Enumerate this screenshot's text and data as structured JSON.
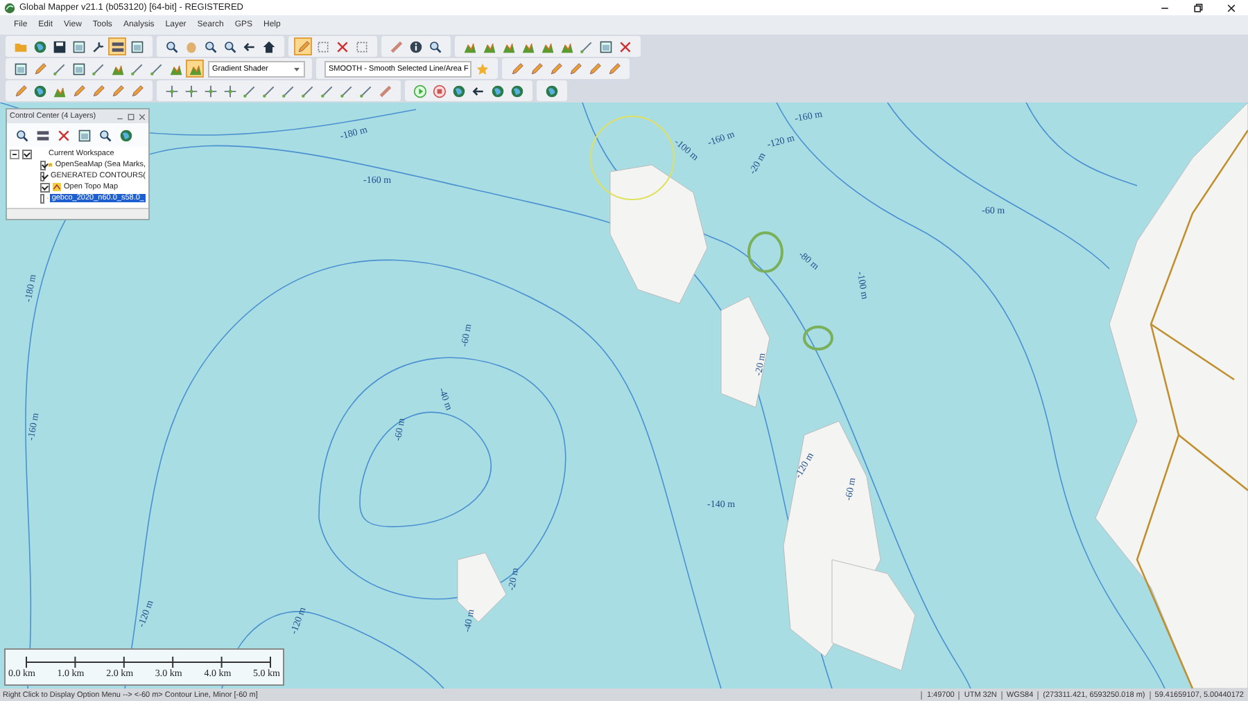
{
  "window": {
    "title": "Global Mapper v21.1 (b053120) [64-bit] - REGISTERED"
  },
  "menu": [
    "File",
    "Edit",
    "View",
    "Tools",
    "Analysis",
    "Layer",
    "Search",
    "GPS",
    "Help"
  ],
  "toolbars": [
    {
      "groups": [
        [
          {
            "kind": "button",
            "selected": false
          },
          {
            "kind": "button",
            "selected": false
          },
          {
            "kind": "button",
            "selected": false
          },
          {
            "kind": "button",
            "selected": false
          },
          {
            "kind": "button",
            "selected": false
          },
          {
            "kind": "button",
            "selected": true
          },
          {
            "kind": "button",
            "selected": false
          }
        ],
        [
          {
            "kind": "button",
            "selected": false
          },
          {
            "kind": "button",
            "selected": false
          },
          {
            "kind": "button",
            "selected": false
          },
          {
            "kind": "button",
            "selected": false
          },
          {
            "kind": "button",
            "selected": false
          },
          {
            "kind": "button",
            "selected": false
          }
        ],
        [
          {
            "kind": "button",
            "selected": true
          },
          {
            "kind": "button",
            "selected": false
          },
          {
            "kind": "button",
            "selected": false
          },
          {
            "kind": "button",
            "selected": false
          }
        ],
        [
          {
            "kind": "button",
            "selected": false
          },
          {
            "kind": "button",
            "selected": false
          },
          {
            "kind": "button",
            "selected": false
          }
        ],
        [
          {
            "kind": "button",
            "selected": false
          },
          {
            "kind": "button",
            "selected": false
          },
          {
            "kind": "button",
            "selected": false
          },
          {
            "kind": "button",
            "selected": false
          },
          {
            "kind": "button",
            "selected": false
          },
          {
            "kind": "button",
            "selected": false
          },
          {
            "kind": "button",
            "selected": false
          },
          {
            "kind": "button",
            "selected": false
          },
          {
            "kind": "button",
            "selected": false
          }
        ]
      ]
    },
    {
      "groups": [
        [
          {
            "kind": "button",
            "selected": false
          },
          {
            "kind": "button",
            "selected": false
          },
          {
            "kind": "button",
            "selected": false
          },
          {
            "kind": "button",
            "selected": false
          },
          {
            "kind": "button",
            "selected": false
          },
          {
            "kind": "button",
            "selected": false
          },
          {
            "kind": "button",
            "selected": false
          },
          {
            "kind": "button",
            "selected": false
          },
          {
            "kind": "button",
            "selected": false
          },
          {
            "kind": "button",
            "selected": true
          },
          {
            "kind": "dropdown",
            "value": "Gradient Shader"
          }
        ],
        [
          {
            "kind": "dropdown",
            "value": "SMOOTH - Smooth Selected Line/Area F"
          },
          {
            "kind": "button",
            "selected": false
          }
        ],
        [
          {
            "kind": "button",
            "selected": false
          },
          {
            "kind": "button",
            "selected": false
          },
          {
            "kind": "button",
            "selected": false
          },
          {
            "kind": "button",
            "selected": false
          },
          {
            "kind": "button",
            "selected": false
          },
          {
            "kind": "button",
            "selected": false
          }
        ]
      ]
    },
    {
      "groups": [
        [
          {
            "kind": "button",
            "selected": false
          },
          {
            "kind": "button",
            "selected": false
          },
          {
            "kind": "button",
            "selected": false
          },
          {
            "kind": "button",
            "selected": false
          },
          {
            "kind": "button",
            "selected": false
          },
          {
            "kind": "button",
            "selected": false
          },
          {
            "kind": "button",
            "selected": false
          }
        ],
        [
          {
            "kind": "button",
            "selected": false
          },
          {
            "kind": "button",
            "selected": false
          },
          {
            "kind": "button",
            "selected": false
          },
          {
            "kind": "button",
            "selected": false
          },
          {
            "kind": "button",
            "selected": false
          },
          {
            "kind": "button",
            "selected": false
          },
          {
            "kind": "button",
            "selected": false
          },
          {
            "kind": "button",
            "selected": false
          },
          {
            "kind": "button",
            "selected": false
          },
          {
            "kind": "button",
            "selected": false
          },
          {
            "kind": "button",
            "selected": false
          },
          {
            "kind": "button",
            "selected": false
          }
        ],
        [
          {
            "kind": "button",
            "selected": false
          },
          {
            "kind": "button",
            "selected": false
          },
          {
            "kind": "button",
            "selected": false
          },
          {
            "kind": "button",
            "selected": false
          },
          {
            "kind": "button",
            "selected": false
          },
          {
            "kind": "button",
            "selected": false
          }
        ],
        [
          {
            "kind": "button",
            "selected": false
          }
        ]
      ]
    }
  ],
  "control_center": {
    "title": "Control Center (4 Layers)",
    "workspace": {
      "label": "Current Workspace",
      "checked": true,
      "expanded": true,
      "children": [
        {
          "label": "OpenSeaMap (Sea Marks,",
          "checked": true,
          "selected": false
        },
        {
          "label": "GENERATED CONTOURS(",
          "checked": true,
          "selected": false
        },
        {
          "label": "Open Topo Map",
          "checked": true,
          "selected": false
        },
        {
          "label": "gebco_2020_n60.0_s58.0_",
          "checked": false,
          "selected": true
        }
      ]
    }
  },
  "map": {
    "contour_labels": [
      "-180 m",
      "-160 m",
      "-160 m",
      "-120 m",
      "-160 m",
      "-100 m",
      "-80 m",
      "-100 m",
      "-60 m",
      "-60 m",
      "-40 m",
      "-60 m",
      "-160 m",
      "-180 m",
      "-120 m",
      "-120 m",
      "-140 m",
      "-120 m",
      "-20 m",
      "-20 m",
      "-40 m",
      "-60 m",
      "-20 m"
    ]
  },
  "scale_bar": [
    "0.0 km",
    "1.0 km",
    "2.0 km",
    "3.0 km",
    "4.0 km",
    "5.0 km"
  ],
  "status_bar": {
    "message": "Right Click to Display Option Menu --> <-60 m> Contour Line, Minor [-60 m]",
    "scale": "1:49700",
    "projection": "UTM 32N",
    "datum": "WGS84",
    "coordinates": "(273311.421, 6593250.018 m)",
    "latlon": "59.41659107, 5.00440172"
  }
}
